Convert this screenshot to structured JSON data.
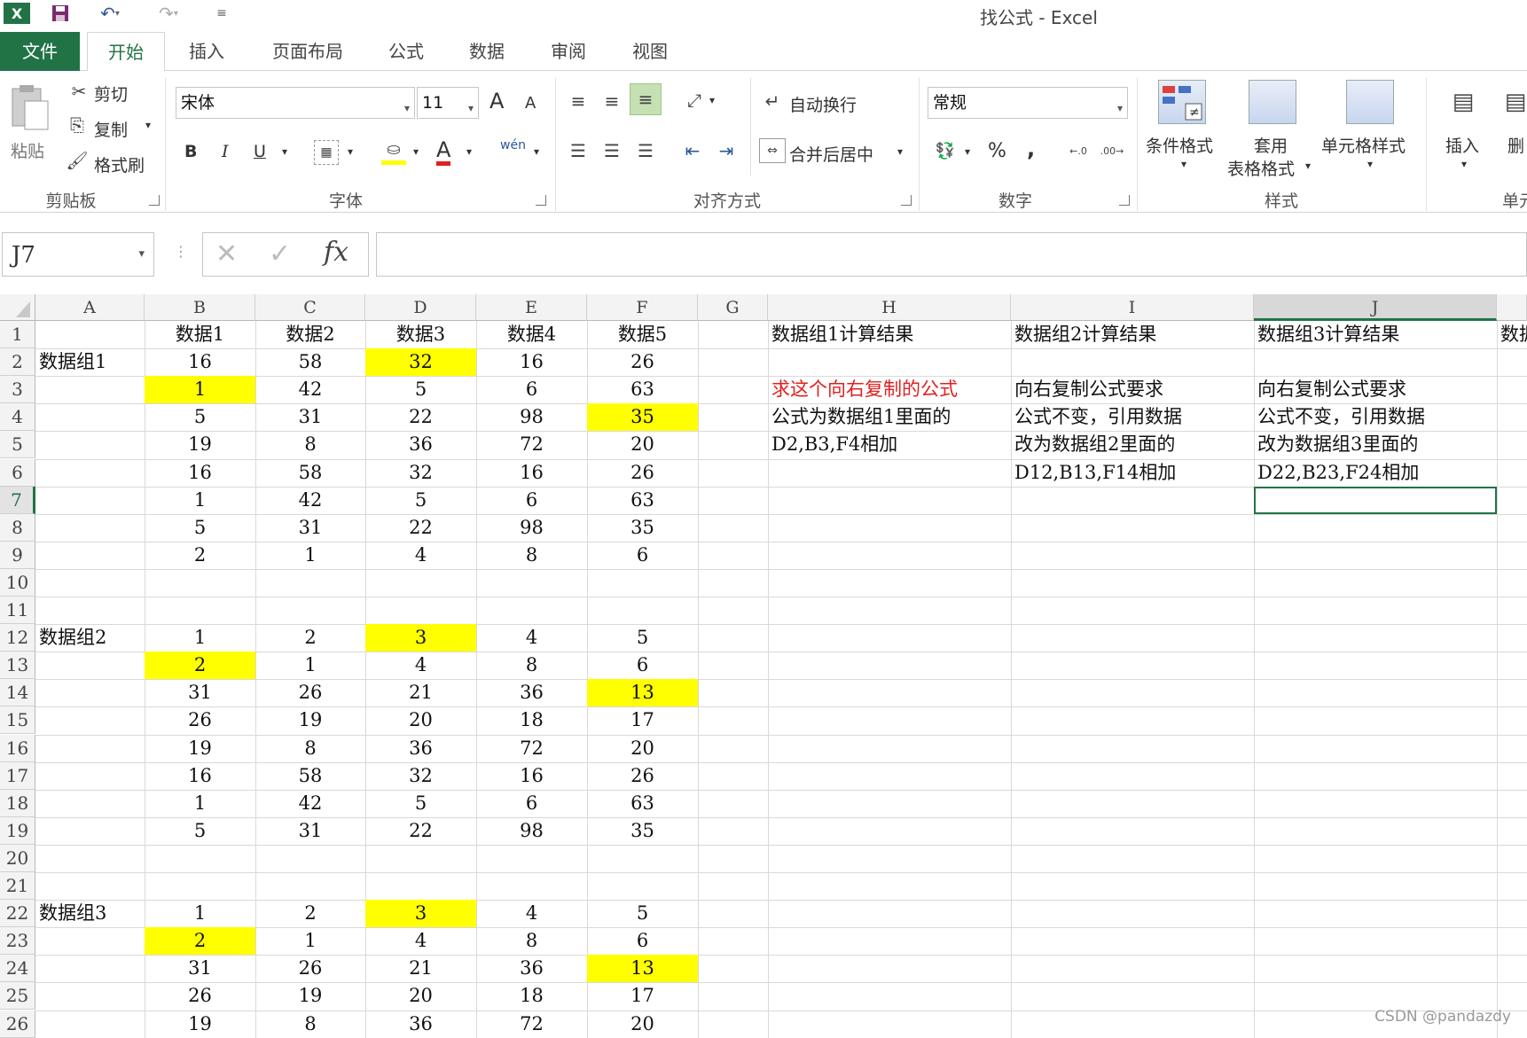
{
  "titlebar": {
    "title": "找公式 - Excel",
    "excel_icon": "excel-logo-icon",
    "save_icon": "save-icon",
    "undo_icon": "undo-icon",
    "redo_icon": "redo-icon",
    "customize_icon": "customize-qat-icon"
  },
  "tabs": [
    "文件",
    "开始",
    "插入",
    "页面布局",
    "公式",
    "数据",
    "审阅",
    "视图"
  ],
  "ribbon": {
    "clipboard": {
      "label": "剪贴板",
      "paste": "粘贴",
      "cut": "剪切",
      "copy": "复制",
      "format_painter": "格式刷"
    },
    "font": {
      "label": "字体",
      "font_name": "宋体",
      "font_size": "11",
      "bold": "B",
      "italic": "I",
      "underline": "U",
      "grow": "A",
      "shrink": "A",
      "phonetic": "wén",
      "font_color": "A"
    },
    "alignment": {
      "label": "对齐方式",
      "wrap": "自动换行",
      "merge": "合并后居中"
    },
    "number": {
      "label": "数字",
      "format": "常规",
      "percent": "%",
      "comma": ","
    },
    "styles": {
      "label": "样式",
      "conditional": "条件格式",
      "table_1": "套用",
      "table_2": "表格格式",
      "cell_styles": "单元格样式"
    },
    "cells": {
      "label": "单元",
      "insert": "插入",
      "delete": "删"
    }
  },
  "formula_bar": {
    "name_box": "J7",
    "cancel": "✕",
    "confirm": "✓",
    "fx": "fx",
    "value": ""
  },
  "sheet": {
    "columns": [
      "A",
      "B",
      "C",
      "D",
      "E",
      "F",
      "G",
      "H",
      "I",
      "J"
    ],
    "selected_column": "J",
    "selected_row": "7",
    "rows": [
      "1",
      "2",
      "3",
      "4",
      "5",
      "6",
      "7",
      "8",
      "9",
      "10",
      "11",
      "12",
      "13",
      "14",
      "15",
      "16",
      "17",
      "18",
      "19",
      "20",
      "21",
      "22",
      "23",
      "24",
      "25",
      "26"
    ],
    "headers": [
      "数据1",
      "数据2",
      "数据3",
      "数据4",
      "数据5"
    ],
    "group_labels": [
      {
        "row": 2,
        "text": "数据组1"
      },
      {
        "row": 12,
        "text": "数据组2"
      },
      {
        "row": 22,
        "text": "数据组3"
      }
    ],
    "data": [
      {
        "row": 2,
        "values": [
          "16",
          "58",
          "32",
          "16",
          "26"
        ]
      },
      {
        "row": 3,
        "values": [
          "1",
          "42",
          "5",
          "6",
          "63"
        ]
      },
      {
        "row": 4,
        "values": [
          "5",
          "31",
          "22",
          "98",
          "35"
        ]
      },
      {
        "row": 5,
        "values": [
          "19",
          "8",
          "36",
          "72",
          "20"
        ]
      },
      {
        "row": 6,
        "values": [
          "16",
          "58",
          "32",
          "16",
          "26"
        ]
      },
      {
        "row": 7,
        "values": [
          "1",
          "42",
          "5",
          "6",
          "63"
        ]
      },
      {
        "row": 8,
        "values": [
          "5",
          "31",
          "22",
          "98",
          "35"
        ]
      },
      {
        "row": 9,
        "values": [
          "2",
          "1",
          "4",
          "8",
          "6"
        ]
      },
      {
        "row": 12,
        "values": [
          "1",
          "2",
          "3",
          "4",
          "5"
        ]
      },
      {
        "row": 13,
        "values": [
          "2",
          "1",
          "4",
          "8",
          "6"
        ]
      },
      {
        "row": 14,
        "values": [
          "31",
          "26",
          "21",
          "36",
          "13"
        ]
      },
      {
        "row": 15,
        "values": [
          "26",
          "19",
          "20",
          "18",
          "17"
        ]
      },
      {
        "row": 16,
        "values": [
          "19",
          "8",
          "36",
          "72",
          "20"
        ]
      },
      {
        "row": 17,
        "values": [
          "16",
          "58",
          "32",
          "16",
          "26"
        ]
      },
      {
        "row": 18,
        "values": [
          "1",
          "42",
          "5",
          "6",
          "63"
        ]
      },
      {
        "row": 19,
        "values": [
          "5",
          "31",
          "22",
          "98",
          "35"
        ]
      },
      {
        "row": 22,
        "values": [
          "1",
          "2",
          "3",
          "4",
          "5"
        ]
      },
      {
        "row": 23,
        "values": [
          "2",
          "1",
          "4",
          "8",
          "6"
        ]
      },
      {
        "row": 24,
        "values": [
          "31",
          "26",
          "21",
          "36",
          "13"
        ]
      },
      {
        "row": 25,
        "values": [
          "26",
          "19",
          "20",
          "18",
          "17"
        ]
      },
      {
        "row": 26,
        "values": [
          "19",
          "8",
          "36",
          "72",
          "20"
        ]
      }
    ],
    "highlights": [
      {
        "row": 2,
        "col": "D"
      },
      {
        "row": 3,
        "col": "B"
      },
      {
        "row": 4,
        "col": "F"
      },
      {
        "row": 12,
        "col": "D"
      },
      {
        "row": 13,
        "col": "B"
      },
      {
        "row": 14,
        "col": "F"
      },
      {
        "row": 22,
        "col": "D"
      },
      {
        "row": 23,
        "col": "B"
      },
      {
        "row": 24,
        "col": "F"
      }
    ],
    "highlight_color": "#ffff00",
    "result_headers": [
      {
        "col": "H",
        "text": "数据组1计算结果"
      },
      {
        "col": "I",
        "text": "数据组2计算结果"
      },
      {
        "col": "J",
        "text": "数据组3计算结果"
      },
      {
        "col": "K",
        "text": "数据"
      }
    ],
    "notes": [
      {
        "col": "H",
        "row": 3,
        "text": "求这个向右复制的公式",
        "color": "#e02020"
      },
      {
        "col": "H",
        "row": 4,
        "text": "公式为数据组1里面的"
      },
      {
        "col": "H",
        "row": 5,
        "text": "D2,B3,F4相加"
      },
      {
        "col": "I",
        "row": 3,
        "text": "向右复制公式要求"
      },
      {
        "col": "I",
        "row": 4,
        "text": "公式不变，引用数据"
      },
      {
        "col": "I",
        "row": 5,
        "text": "改为数据组2里面的"
      },
      {
        "col": "I",
        "row": 6,
        "text": "D12,B13,F14相加"
      },
      {
        "col": "J",
        "row": 3,
        "text": "向右复制公式要求"
      },
      {
        "col": "J",
        "row": 4,
        "text": "公式不变，引用数据"
      },
      {
        "col": "J",
        "row": 5,
        "text": "改为数据组3里面的"
      },
      {
        "col": "J",
        "row": 6,
        "text": "D22,B23,F24相加"
      }
    ]
  },
  "watermark": "CSDN @pandazdy",
  "accent_color": "#217346"
}
